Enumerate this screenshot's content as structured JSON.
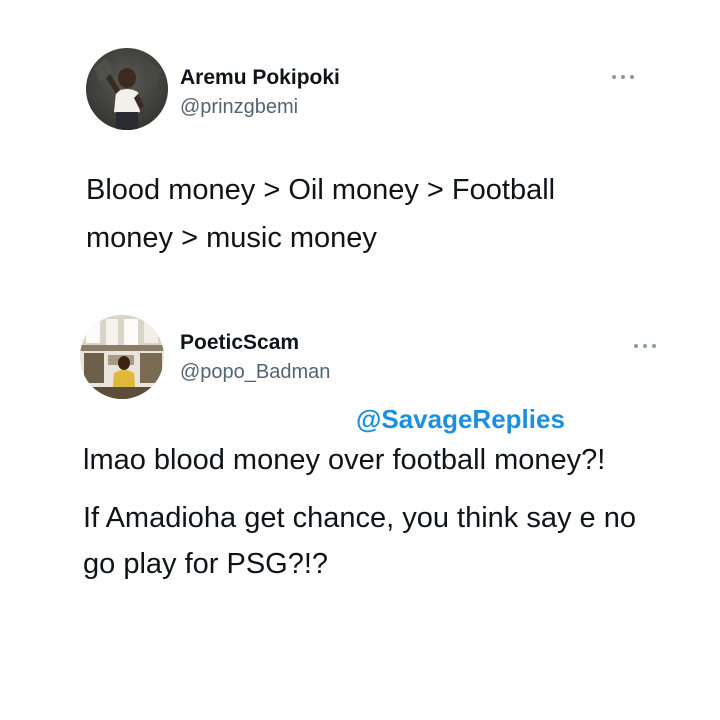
{
  "colors": {
    "text_primary": "#0f1419",
    "text_secondary": "#536471",
    "watermark": "#1d8fe0",
    "more_dots": "#8b98a5"
  },
  "tweets": [
    {
      "display_name": "Aremu Pokipoki",
      "handle": "@prinzgbemi",
      "more_icon": "more-horizontal-icon",
      "text": "Blood money > Oil money > Football money > music money"
    },
    {
      "display_name": "PoeticScam",
      "handle": "@popo_Badman",
      "more_icon": "more-horizontal-icon",
      "paragraphs": [
        "lmao blood money over football money?!",
        "If Amadioha get chance, you think say e no go play for PSG?!?"
      ]
    }
  ],
  "watermark": "@SavageReplies"
}
